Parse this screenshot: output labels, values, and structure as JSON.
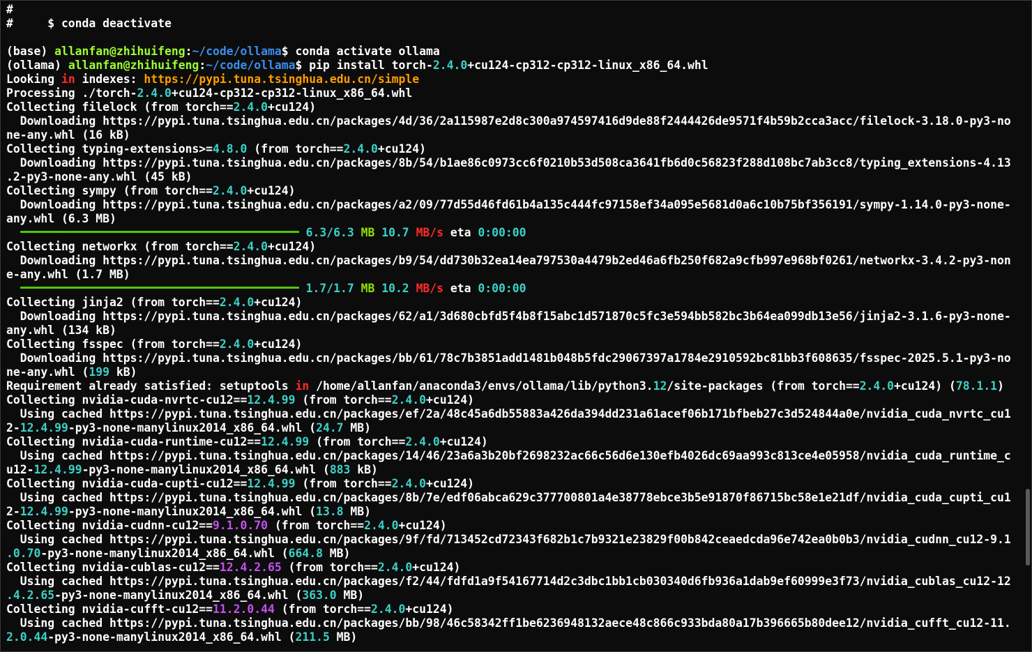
{
  "colors": {
    "fg": "#ffffff",
    "cyan": "#3cd1c7",
    "green": "#8fe000",
    "red": "#ff2a2a",
    "magenta": "#c64ff0",
    "orange": "#ff9d00",
    "userhost": "#9cff33",
    "path": "#3b8eea"
  },
  "lines": [
    [
      {
        "t": "#"
      }
    ],
    [
      {
        "t": "#     $ conda deactivate"
      }
    ],
    [
      {
        "t": ""
      }
    ],
    [
      {
        "t": "(base) "
      },
      {
        "t": "allanfan@zhihuifeng",
        "c": "userhost"
      },
      {
        "t": ":"
      },
      {
        "t": "~/code/ollama",
        "c": "path"
      },
      {
        "t": "$ conda activate ollama"
      }
    ],
    [
      {
        "t": "(ollama) "
      },
      {
        "t": "allanfan@zhihuifeng",
        "c": "userhost"
      },
      {
        "t": ":"
      },
      {
        "t": "~/code/ollama",
        "c": "path"
      },
      {
        "t": "$ pip install torch-"
      },
      {
        "t": "2.4.0",
        "c": "cyan"
      },
      {
        "t": "+cu124-cp312-cp312-linux_x86_64.whl"
      }
    ],
    [
      {
        "t": "Looking "
      },
      {
        "t": "in",
        "c": "red"
      },
      {
        "t": " indexes: "
      },
      {
        "t": "https://pypi.tuna.tsinghua.edu.cn/simple",
        "c": "orange"
      }
    ],
    [
      {
        "t": "Processing ./torch-"
      },
      {
        "t": "2.4.0",
        "c": "cyan"
      },
      {
        "t": "+cu124-cp312-cp312-linux_x86_64.whl"
      }
    ],
    [
      {
        "t": "Collecting filelock (from torch=="
      },
      {
        "t": "2.4.0",
        "c": "cyan"
      },
      {
        "t": "+cu124)"
      }
    ],
    [
      {
        "t": "  Downloading https://pypi.tuna.tsinghua.edu.cn/packages/4d/36/2a115987e2d8c300a974597416d9de88f2444426de9571f4b59b2cca3acc/filelock-3.18.0-py3-no"
      }
    ],
    [
      {
        "t": "ne-any.whl (16 kB)"
      }
    ],
    [
      {
        "t": "Collecting typing-extensions>="
      },
      {
        "t": "4.8.0",
        "c": "cyan"
      },
      {
        "t": " (from torch=="
      },
      {
        "t": "2.4.0",
        "c": "cyan"
      },
      {
        "t": "+cu124)"
      }
    ],
    [
      {
        "t": "  Downloading https://pypi.tuna.tsinghua.edu.cn/packages/8b/54/b1ae86c0973cc6f0210b53d508ca3641fb6d0c56823f288d108bc7ab3cc8/typing_extensions-4.13"
      }
    ],
    [
      {
        "t": ".2-py3-none-any.whl (45 kB)"
      }
    ],
    [
      {
        "t": "Collecting sympy (from torch=="
      },
      {
        "t": "2.4.0",
        "c": "cyan"
      },
      {
        "t": "+cu124)"
      }
    ],
    [
      {
        "t": "  Downloading https://pypi.tuna.tsinghua.edu.cn/packages/a2/09/77d55d46fd61b4a135c444fc97158ef34a095e5681d0a6c10b75bf356191/sympy-1.14.0-py3-none-"
      }
    ],
    [
      {
        "t": "any.whl (6.3 MB)"
      }
    ],
    [
      {
        "t": "  "
      },
      {
        "bar": true
      },
      {
        "t": " "
      },
      {
        "t": "6.3/6.3",
        "c": "cyan"
      },
      {
        "t": " "
      },
      {
        "t": "MB",
        "c": "green"
      },
      {
        "t": " "
      },
      {
        "t": "10.7",
        "c": "cyan"
      },
      {
        "t": " "
      },
      {
        "t": "MB/s",
        "c": "red"
      },
      {
        "t": " eta "
      },
      {
        "t": "0:00:00",
        "c": "cyan"
      }
    ],
    [
      {
        "t": "Collecting networkx (from torch=="
      },
      {
        "t": "2.4.0",
        "c": "cyan"
      },
      {
        "t": "+cu124)"
      }
    ],
    [
      {
        "t": "  Downloading https://pypi.tuna.tsinghua.edu.cn/packages/b9/54/dd730b32ea14ea797530a4479b2ed46a6fb250f682a9cfb997e968bf0261/networkx-3.4.2-py3-non"
      }
    ],
    [
      {
        "t": "e-any.whl (1.7 MB)"
      }
    ],
    [
      {
        "t": "  "
      },
      {
        "bar": true
      },
      {
        "t": " "
      },
      {
        "t": "1.7/1.7",
        "c": "cyan"
      },
      {
        "t": " "
      },
      {
        "t": "MB",
        "c": "green"
      },
      {
        "t": " "
      },
      {
        "t": "10.2",
        "c": "cyan"
      },
      {
        "t": " "
      },
      {
        "t": "MB/s",
        "c": "red"
      },
      {
        "t": " eta "
      },
      {
        "t": "0:00:00",
        "c": "cyan"
      }
    ],
    [
      {
        "t": "Collecting jinja2 (from torch=="
      },
      {
        "t": "2.4.0",
        "c": "cyan"
      },
      {
        "t": "+cu124)"
      }
    ],
    [
      {
        "t": "  Downloading https://pypi.tuna.tsinghua.edu.cn/packages/62/a1/3d680cbfd5f4b8f15abc1d571870c5fc3e594bb582bc3b64ea099db13e56/jinja2-3.1.6-py3-none-"
      }
    ],
    [
      {
        "t": "any.whl (134 kB)"
      }
    ],
    [
      {
        "t": "Collecting fsspec (from torch=="
      },
      {
        "t": "2.4.0",
        "c": "cyan"
      },
      {
        "t": "+cu124)"
      }
    ],
    [
      {
        "t": "  Downloading https://pypi.tuna.tsinghua.edu.cn/packages/bb/61/78c7b3851add1481b048b5fdc29067397a1784e2910592bc81bb3f608635/fsspec-2025.5.1-py3-no"
      }
    ],
    [
      {
        "t": "ne-any.whl ("
      },
      {
        "t": "199",
        "c": "cyan"
      },
      {
        "t": " kB)"
      }
    ],
    [
      {
        "t": "Requirement already satisfied: setuptools "
      },
      {
        "t": "in",
        "c": "red"
      },
      {
        "t": " /home/allanfan/anaconda3/envs/ollama/lib/python3."
      },
      {
        "t": "12",
        "c": "cyan"
      },
      {
        "t": "/site-packages (from torch=="
      },
      {
        "t": "2.4.0",
        "c": "cyan"
      },
      {
        "t": "+cu124) ("
      },
      {
        "t": "78.1.1",
        "c": "cyan"
      },
      {
        "t": ")"
      }
    ],
    [
      {
        "t": "Collecting nvidia-cuda-nvrtc-cu12=="
      },
      {
        "t": "12.4.99",
        "c": "cyan"
      },
      {
        "t": " (from torch=="
      },
      {
        "t": "2.4.0",
        "c": "cyan"
      },
      {
        "t": "+cu124)"
      }
    ],
    [
      {
        "t": "  Using cached https://pypi.tuna.tsinghua.edu.cn/packages/ef/2a/48c45a6db55883a426da394dd231a61acef06b171bfbeb27c3d524844a0e/nvidia_cuda_nvrtc_cu1"
      }
    ],
    [
      {
        "t": "2-"
      },
      {
        "t": "12.4.99",
        "c": "cyan"
      },
      {
        "t": "-py3-none-manylinux2014_x86_64.whl ("
      },
      {
        "t": "24.7",
        "c": "cyan"
      },
      {
        "t": " MB)"
      }
    ],
    [
      {
        "t": "Collecting nvidia-cuda-runtime-cu12=="
      },
      {
        "t": "12.4.99",
        "c": "cyan"
      },
      {
        "t": " (from torch=="
      },
      {
        "t": "2.4.0",
        "c": "cyan"
      },
      {
        "t": "+cu124)"
      }
    ],
    [
      {
        "t": "  Using cached https://pypi.tuna.tsinghua.edu.cn/packages/14/46/23a6a3b20bf2698232ac66c56d6e130efb4026dc69aa993c813ce4e05958/nvidia_cuda_runtime_c"
      }
    ],
    [
      {
        "t": "u12-"
      },
      {
        "t": "12.4.99",
        "c": "cyan"
      },
      {
        "t": "-py3-none-manylinux2014_x86_64.whl ("
      },
      {
        "t": "883",
        "c": "cyan"
      },
      {
        "t": " kB)"
      }
    ],
    [
      {
        "t": "Collecting nvidia-cuda-cupti-cu12=="
      },
      {
        "t": "12.4.99",
        "c": "cyan"
      },
      {
        "t": " (from torch=="
      },
      {
        "t": "2.4.0",
        "c": "cyan"
      },
      {
        "t": "+cu124)"
      }
    ],
    [
      {
        "t": "  Using cached https://pypi.tuna.tsinghua.edu.cn/packages/8b/7e/edf06abca629c377700801a4e38778ebce3b5e91870f86715bc58e1e21df/nvidia_cuda_cupti_cu1"
      }
    ],
    [
      {
        "t": "2-"
      },
      {
        "t": "12.4.99",
        "c": "cyan"
      },
      {
        "t": "-py3-none-manylinux2014_x86_64.whl ("
      },
      {
        "t": "13.8",
        "c": "cyan"
      },
      {
        "t": " MB)"
      }
    ],
    [
      {
        "t": "Collecting nvidia-cudnn-cu12=="
      },
      {
        "t": "9.1.0.70",
        "c": "magenta"
      },
      {
        "t": " (from torch=="
      },
      {
        "t": "2.4.0",
        "c": "cyan"
      },
      {
        "t": "+cu124)"
      }
    ],
    [
      {
        "t": "  Using cached https://pypi.tuna.tsinghua.edu.cn/packages/9f/fd/713452cd72343f682b1c7b9321e23829f00b842ceaedcda96e742ea0b0b3/nvidia_cudnn_cu12-9.1"
      }
    ],
    [
      {
        "t": ".0.70",
        "c": "cyan"
      },
      {
        "t": "-py3-none-manylinux2014_x86_64.whl ("
      },
      {
        "t": "664.8",
        "c": "cyan"
      },
      {
        "t": " MB)"
      }
    ],
    [
      {
        "t": "Collecting nvidia-cublas-cu12=="
      },
      {
        "t": "12.4.2.65",
        "c": "magenta"
      },
      {
        "t": " (from torch=="
      },
      {
        "t": "2.4.0",
        "c": "cyan"
      },
      {
        "t": "+cu124)"
      }
    ],
    [
      {
        "t": "  Using cached https://pypi.tuna.tsinghua.edu.cn/packages/f2/44/fdfd1a9f54167714d2c3dbc1bb1cb030340d6fb936a1dab9ef60999e3f73/nvidia_cublas_cu12-12"
      }
    ],
    [
      {
        "t": ".4.2.65",
        "c": "cyan"
      },
      {
        "t": "-py3-none-manylinux2014_x86_64.whl ("
      },
      {
        "t": "363.0",
        "c": "cyan"
      },
      {
        "t": " MB)"
      }
    ],
    [
      {
        "t": "Collecting nvidia-cufft-cu12=="
      },
      {
        "t": "11.2.0.44",
        "c": "magenta"
      },
      {
        "t": " (from torch=="
      },
      {
        "t": "2.4.0",
        "c": "cyan"
      },
      {
        "t": "+cu124)"
      }
    ],
    [
      {
        "t": "  Using cached https://pypi.tuna.tsinghua.edu.cn/packages/bb/98/46c58342ff1be6236948132aece48c866c933bda80a17b396665b80dee12/nvidia_cufft_cu12-11."
      }
    ],
    [
      {
        "t": "2.0.44",
        "c": "cyan"
      },
      {
        "t": "-py3-none-manylinux2014_x86_64.whl ("
      },
      {
        "t": "211.5",
        "c": "cyan"
      },
      {
        "t": " MB)"
      }
    ]
  ]
}
